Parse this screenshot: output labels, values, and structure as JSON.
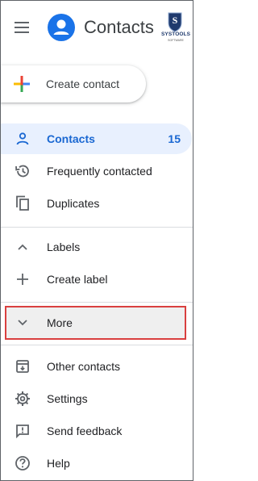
{
  "header": {
    "app_title": "Contacts",
    "menu_icon": "hamburger-menu-icon",
    "app_icon": "contacts-logo-icon",
    "brand": {
      "name": "SYSTOOLS",
      "tagline": "SOFTWARE",
      "logo_icon": "systools-shield-logo"
    }
  },
  "create_button": {
    "label": "Create contact",
    "icon": "colored-plus-icon"
  },
  "nav": {
    "primary": [
      {
        "label": "Contacts",
        "count": "15",
        "icon": "person-icon",
        "active": true
      },
      {
        "label": "Frequently contacted",
        "icon": "history-icon",
        "active": false
      },
      {
        "label": "Duplicates",
        "icon": "copy-icon",
        "active": false
      }
    ],
    "labels_section": [
      {
        "label": "Labels",
        "icon": "chevron-up-icon"
      },
      {
        "label": "Create label",
        "icon": "plus-icon"
      }
    ],
    "more": {
      "label": "More",
      "icon": "chevron-down-icon",
      "highlighted": true
    },
    "secondary": [
      {
        "label": "Other contacts",
        "icon": "archive-icon"
      },
      {
        "label": "Settings",
        "icon": "gear-icon"
      },
      {
        "label": "Send feedback",
        "icon": "feedback-icon"
      },
      {
        "label": "Help",
        "icon": "help-icon"
      }
    ]
  },
  "colors": {
    "accent": "#1a73e8",
    "active_bg": "#e8f0fe",
    "active_text": "#1967d2",
    "highlight_border": "#d93f3f",
    "highlight_bg": "#efefef"
  }
}
